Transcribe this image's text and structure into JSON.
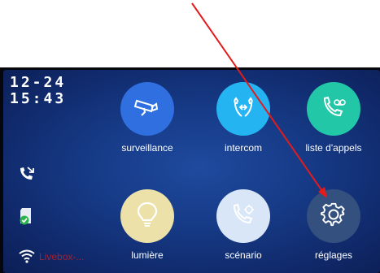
{
  "status": {
    "date": "12-24",
    "time": "15:43",
    "wifi_label": "Livebox-..."
  },
  "apps": [
    {
      "label": "surveillance",
      "icon": "cctv-camera-icon",
      "color": "#2f6fe0"
    },
    {
      "label": "intercom",
      "icon": "intercom-phone-icon",
      "color": "#25b4f2"
    },
    {
      "label": "liste d'appels",
      "icon": "call-log-icon",
      "color": "#22c7a8"
    },
    {
      "label": "lumière",
      "icon": "light-bulb-icon",
      "color": "#ece1a8"
    },
    {
      "label": "scénario",
      "icon": "scenario-phone-icon",
      "color": "#d9e6f7"
    },
    {
      "label": "réglages",
      "icon": "gear-icon",
      "color": "#34507e"
    }
  ],
  "annotation": {
    "arrow_color": "#e31b1b"
  }
}
